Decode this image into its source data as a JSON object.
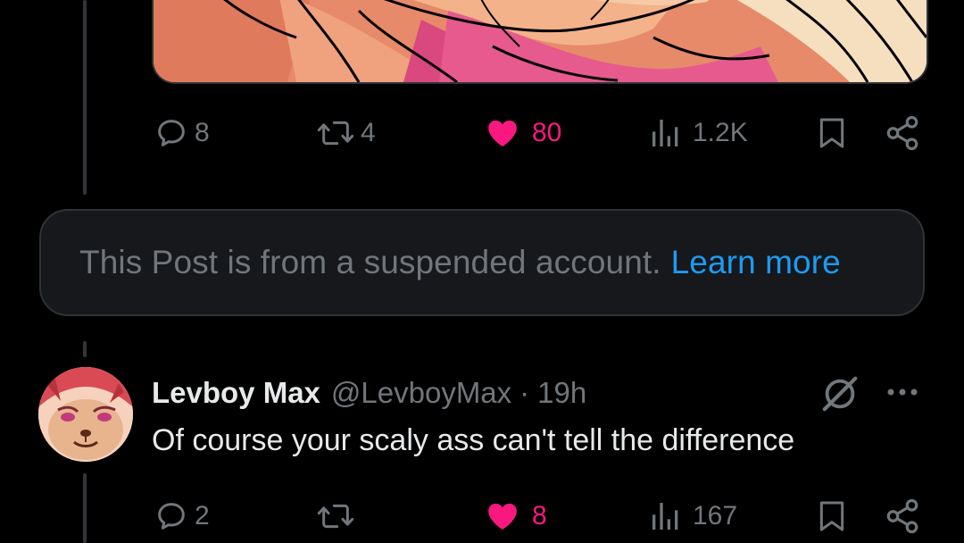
{
  "post1": {
    "replies": "8",
    "reposts": "4",
    "likes": "80",
    "views": "1.2K",
    "liked": true
  },
  "suspended_notice": {
    "text": "This Post is from a suspended account.",
    "link": "Learn more"
  },
  "post2": {
    "author_name": "Levboy Max",
    "author_handle": "@LevboyMax",
    "separator": "·",
    "time": "19h",
    "text": "Of course your scaly ass can't tell the difference",
    "replies": "2",
    "reposts": "",
    "likes": "8",
    "views": "167",
    "liked": true
  },
  "colors": {
    "background": "#000000",
    "card": "#16181c",
    "muted_text": "#71767b",
    "like_pink": "#f91880",
    "link_blue": "#1d9bf0"
  },
  "icons": {
    "reply": "reply-icon",
    "repost": "repost-icon",
    "like": "heart-icon",
    "views": "views-icon",
    "bookmark": "bookmark-icon",
    "share": "share-icon",
    "grok": "grok-icon",
    "more": "more-icon"
  }
}
